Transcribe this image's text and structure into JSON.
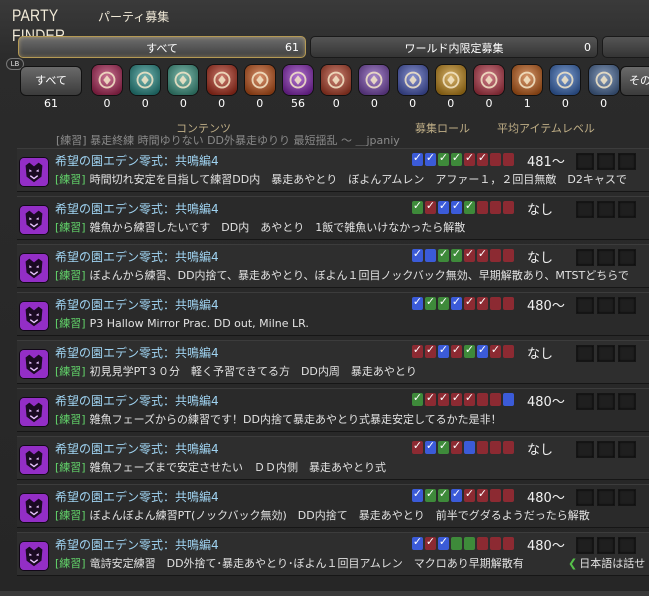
{
  "window": {
    "title_en": "PARTY FINDER",
    "title_jp": "パーティ募集",
    "lb_badge": "LB"
  },
  "tabs": [
    {
      "label": "すべて",
      "count": "61"
    },
    {
      "label": "ワールド内限定募集",
      "count": "0"
    },
    {
      "label": "",
      "count": ""
    }
  ],
  "categories": {
    "all_label": "すべて",
    "all_count": "61",
    "other_label": "その",
    "items": [
      {
        "icon": "roulette-icon",
        "count": "0",
        "color": "#b02a5a"
      },
      {
        "icon": "dungeon-icon",
        "count": "0",
        "color": "#2a8f8a"
      },
      {
        "icon": "guildhest-icon",
        "count": "0",
        "color": "#3f9a86"
      },
      {
        "icon": "trial-icon",
        "count": "0",
        "color": "#b0321f"
      },
      {
        "icon": "raid-icon",
        "count": "0",
        "color": "#c2551c"
      },
      {
        "icon": "high-end-duty-icon",
        "count": "56",
        "color": "#8a2ab8"
      },
      {
        "icon": "pvp-icon",
        "count": "0",
        "color": "#b2412a"
      },
      {
        "icon": "gold-saucer-icon",
        "count": "0",
        "color": "#7a4ab0"
      },
      {
        "icon": "deep-dungeon-icon",
        "count": "0",
        "color": "#4a5ab8"
      },
      {
        "icon": "treasure-hunt-icon",
        "count": "0",
        "color": "#c28a1c"
      },
      {
        "icon": "fate-icon",
        "count": "0",
        "color": "#b83a4a"
      },
      {
        "icon": "field-operations-icon",
        "count": "1",
        "color": "#c2601c"
      },
      {
        "icon": "variant-dungeon-icon",
        "count": "0",
        "color": "#3a6ab8"
      },
      {
        "icon": "the-hunt-icon",
        "count": "0",
        "color": "#4a6a9a"
      }
    ]
  },
  "columns": {
    "content": "コンテンツ",
    "role": "募集ロール",
    "ilvl": "平均アイテムレベル"
  },
  "prev_row_tail": "[練習] 暴走終練 時間ゆりない DD外暴走ゆりり 最短揺乱 ～ ＿jpaniy",
  "listings": [
    {
      "duty": "希望の園エデン零式：共鳴編4",
      "tag": "[練習]",
      "desc": "時間切れ安定を目指して練習DD内　暴走あやとり　ぼよんアムレン　アファー１，２回目無敵　D2キャスで",
      "roles": [
        "tank-filled",
        "tank-filled",
        "healer-filled",
        "healer-filled",
        "dps-filled",
        "dps-filled",
        "dps",
        "dps"
      ],
      "ilvl": "481～"
    },
    {
      "duty": "希望の園エデン零式：共鳴編4",
      "tag": "[練習]",
      "desc": "雑魚から練習したいです　DD内　あやとり　1飯で雑魚いけなかったら解散",
      "roles": [
        "healer-filled",
        "dps-filled",
        "tank-filled",
        "tank-filled",
        "healer-filled",
        "dps",
        "dps",
        "dps"
      ],
      "ilvl": "なし"
    },
    {
      "duty": "希望の園エデン零式：共鳴編4",
      "tag": "[練習]",
      "desc": "ぼよんから練習、DD内捨て、暴走あやとり、ぼよん１回目ノックバック無効、早期解散あり、MTSTどちらで",
      "roles": [
        "tank-filled",
        "tank",
        "healer-filled",
        "healer-filled",
        "dps-filled",
        "dps-filled",
        "dps",
        "dps"
      ],
      "ilvl": "なし"
    },
    {
      "duty": "希望の園エデン零式：共鳴編4",
      "tag": "[練習]",
      "desc": "P3 Hallow Mirror Prac. DD out, Milne LR.",
      "roles": [
        "tank-filled",
        "healer-filled",
        "healer-filled",
        "tank-filled",
        "dps-filled",
        "dps-filled",
        "dps",
        "dps"
      ],
      "ilvl": "480～"
    },
    {
      "duty": "希望の園エデン零式：共鳴編4",
      "tag": "[練習]",
      "desc": "初見見学PT３０分　軽く予習できてる方　DD内周　暴走あやとり",
      "roles": [
        "dps-filled",
        "dps-filled",
        "tank-filled",
        "dps-filled",
        "healer-filled",
        "tank-filled",
        "dps-filled",
        "dps"
      ],
      "ilvl": "なし"
    },
    {
      "duty": "希望の園エデン零式：共鳴編4",
      "tag": "[練習]",
      "desc": "雑魚フェーズからの練習です！DD内捨て暴走あやとり式暴走安定してるかた是非！",
      "roles": [
        "healer-filled",
        "dps-filled",
        "dps-filled",
        "dps-filled",
        "dps-filled",
        "dps",
        "dps",
        "tank"
      ],
      "ilvl": "480～"
    },
    {
      "duty": "希望の園エデン零式：共鳴編4",
      "tag": "[練習]",
      "desc": "雑魚フェーズまで安定させたい　ＤＤ内側　暴走あやとり式",
      "roles": [
        "dps-filled",
        "tank-filled",
        "healer-filled",
        "dps-filled",
        "tank",
        "dps",
        "dps",
        "dps"
      ],
      "ilvl": "なし"
    },
    {
      "duty": "希望の園エデン零式：共鳴編4",
      "tag": "[練習]",
      "desc": "ぼよんぼよん練習PT(ノックバック無効)　DD内捨て　暴走あやとり　前半でグダるようだったら解散",
      "roles": [
        "tank-filled",
        "healer-filled",
        "healer-filled",
        "tank-filled",
        "dps-filled",
        "dps-filled",
        "dps",
        "dps"
      ],
      "ilvl": "480～"
    },
    {
      "duty": "希望の園エデン零式：共鳴編4",
      "tag": "[練習]",
      "desc": "竜詩安定練習　DD外捨て･暴走あやとり･ぼよん１回目アムレン　マクロあり早期解散有",
      "roles": [
        "tank-filled",
        "dps-filled",
        "tank-filled",
        "healer",
        "healer",
        "dps",
        "dps",
        "dps"
      ],
      "ilvl": "480～",
      "lang": "日本語は話せ"
    }
  ]
}
